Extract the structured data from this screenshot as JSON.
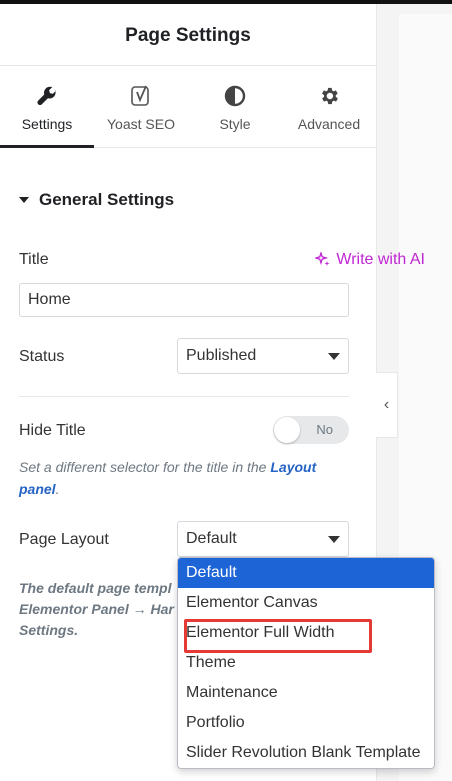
{
  "header": {
    "title": "Page Settings"
  },
  "tabs": [
    {
      "label": "Settings",
      "icon": "wrench-icon",
      "active": true
    },
    {
      "label": "Yoast SEO",
      "icon": "yoast-icon"
    },
    {
      "label": "Style",
      "icon": "half-circle-icon"
    },
    {
      "label": "Advanced",
      "icon": "gear-icon"
    }
  ],
  "section": {
    "title": "General Settings"
  },
  "fields": {
    "title_label": "Title",
    "ai_link": "Write with AI",
    "title_value": "Home",
    "status_label": "Status",
    "status_value": "Published",
    "hide_title_label": "Hide Title",
    "hide_title_toggle": "No",
    "hide_title_desc_prefix": "Set a different selector for the title in the ",
    "hide_title_desc_link": "Layout panel",
    "hide_title_desc_suffix": ".",
    "page_layout_label": "Page Layout",
    "page_layout_value": "Default",
    "page_layout_desc_line1": "The default page templ",
    "page_layout_desc_line2": "Elementor Panel → Har",
    "page_layout_desc_line3": "Settings."
  },
  "dropdown": {
    "options": [
      "Default",
      "Elementor Canvas",
      "Elementor Full Width",
      "Theme",
      "Maintenance",
      "Portfolio",
      "Slider Revolution Blank Template"
    ],
    "selected_index": 0,
    "highlighted_index": 2
  },
  "colors": {
    "ai_accent": "#c026d3",
    "link": "#2563c4",
    "selected_option": "#1d65d6",
    "highlight_box": "#e53935"
  }
}
